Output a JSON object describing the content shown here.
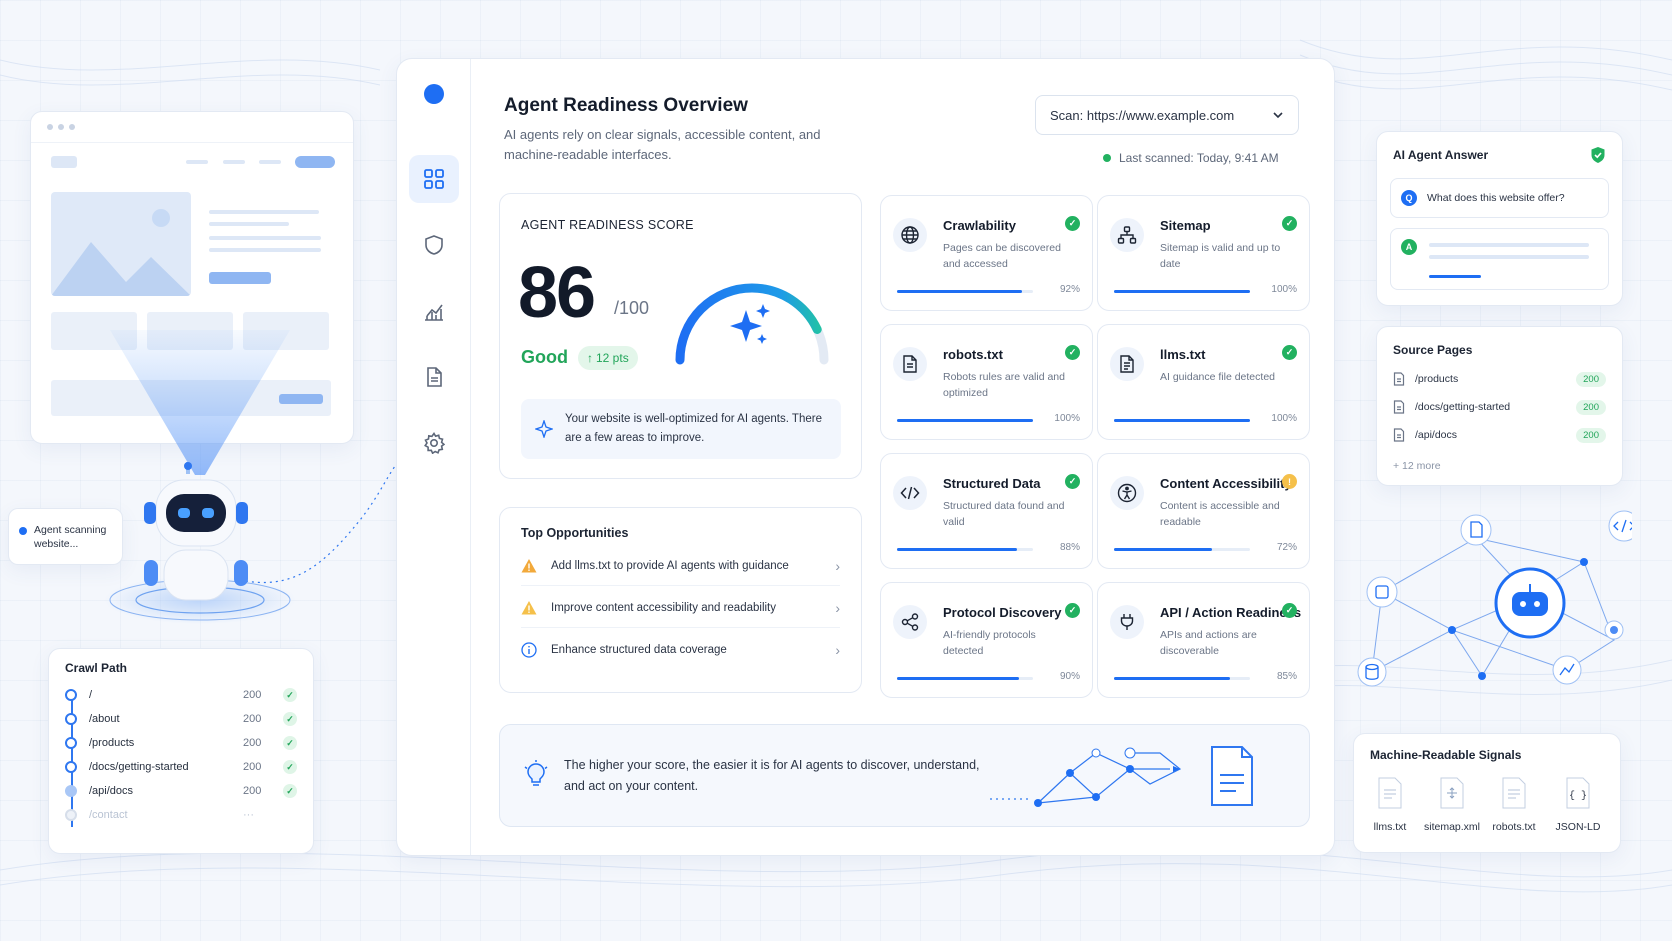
{
  "agent_bubble": {
    "text": "Agent scanning website..."
  },
  "crawl": {
    "title": "Crawl Path",
    "rows": [
      {
        "path": "/",
        "code": "200"
      },
      {
        "path": "/about",
        "code": "200"
      },
      {
        "path": "/products",
        "code": "200"
      },
      {
        "path": "/docs/getting-started",
        "code": "200"
      },
      {
        "path": "/api/docs",
        "code": "200"
      },
      {
        "path": "/contact",
        "code": "···"
      }
    ]
  },
  "dashboard": {
    "title": "Agent Readiness Overview",
    "subtitle": "AI agents rely on clear signals, accessible content, and machine-readable interfaces.",
    "scan_label": "Scan: https://www.example.com",
    "last_scanned": "Last scanned: Today, 9:41 AM",
    "nav": [
      "grid-icon",
      "shield-icon",
      "chart-icon",
      "document-icon",
      "gear-icon"
    ]
  },
  "score": {
    "label": "AGENT READINESS SCORE",
    "value": "86",
    "max": "/100",
    "status": "Good",
    "delta": "12 pts",
    "gauge_fraction": 0.86,
    "note": "Your website is well-optimized for AI agents. There are a few areas to improve."
  },
  "opportunities": {
    "title": "Top Opportunities",
    "items": [
      {
        "label": "Add llms.txt to provide AI agents with guidance",
        "icon": "warning-icon",
        "color": "#f2a93b"
      },
      {
        "label": "Improve content accessibility and readability",
        "icon": "warning-icon",
        "color": "#f5c04a"
      },
      {
        "label": "Enhance structured data coverage",
        "icon": "info-icon",
        "color": "#1e6ef3"
      }
    ]
  },
  "metrics": [
    {
      "name": "Crawlability",
      "desc": "Pages can be discovered and accessed",
      "pct": "92%",
      "value": 0.92,
      "icon": "globe-icon",
      "status": "ok"
    },
    {
      "name": "Sitemap",
      "desc": "Sitemap is valid and up to date",
      "pct": "100%",
      "value": 1.0,
      "icon": "sitemap-icon",
      "status": "ok"
    },
    {
      "name": "robots.txt",
      "desc": "Robots rules are valid and optimized",
      "pct": "100%",
      "value": 1.0,
      "icon": "file-icon",
      "status": "ok"
    },
    {
      "name": "llms.txt",
      "desc": "AI guidance file detected",
      "pct": "100%",
      "value": 1.0,
      "icon": "file-text-icon",
      "status": "ok"
    },
    {
      "name": "Structured Data",
      "desc": "Structured data found and valid",
      "pct": "88%",
      "value": 0.88,
      "icon": "code-icon",
      "status": "ok"
    },
    {
      "name": "Content Accessibility",
      "desc": "Content is accessible and readable",
      "pct": "72%",
      "value": 0.72,
      "icon": "accessibility-icon",
      "status": "warn"
    },
    {
      "name": "Protocol Discovery",
      "desc": "AI-friendly protocols detected",
      "pct": "90%",
      "value": 0.9,
      "icon": "share-icon",
      "status": "ok"
    },
    {
      "name": "API / Action Readiness",
      "desc": "APIs and actions are discoverable",
      "pct": "85%",
      "value": 0.85,
      "icon": "plug-icon",
      "status": "ok"
    }
  ],
  "banner": {
    "text": "The higher your score, the easier it is for AI agents to discover, understand, and act on your content."
  },
  "answer": {
    "title": "AI Agent Answer",
    "question": "What does this website offer?",
    "q_badge": "Q",
    "a_badge": "A"
  },
  "sources": {
    "title": "Source Pages",
    "rows": [
      {
        "path": "/products",
        "code": "200"
      },
      {
        "path": "/docs/getting-started",
        "code": "200"
      },
      {
        "path": "/api/docs",
        "code": "200"
      }
    ],
    "more": "+ 12 more"
  },
  "signals": {
    "title": "Machine-Readable Signals",
    "items": [
      "llms.txt",
      "sitemap.xml",
      "robots.txt",
      "JSON-LD"
    ]
  },
  "colors": {
    "accent": "#1e6ef3",
    "success": "#22b160",
    "warning": "#f5c04a"
  }
}
